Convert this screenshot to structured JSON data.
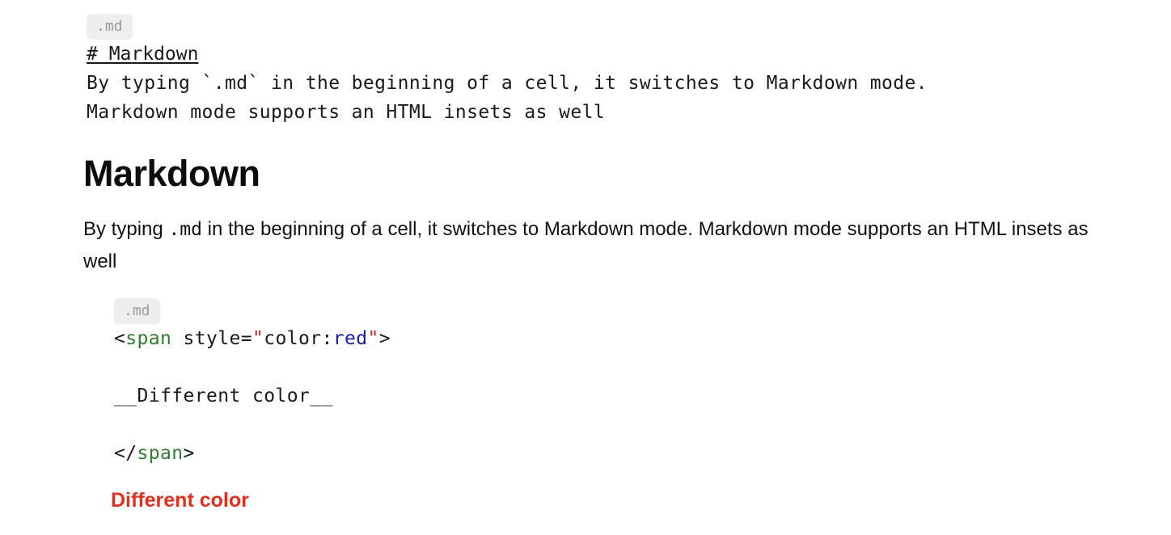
{
  "cell1": {
    "badge": ".md",
    "source_heading": "# Markdown",
    "source_line1": "By typing `.md` in the beginning of a cell, it switches to Markdown mode.",
    "source_line2": "Markdown mode supports an HTML insets as well",
    "rendered_heading": "Markdown",
    "rendered_text_before_code": "By typing ",
    "rendered_code": ".md",
    "rendered_text_after_code": " in the beginning of a cell, it switches to Markdown mode. Markdown mode supports an HTML insets as well"
  },
  "cell2": {
    "badge": ".md",
    "code": {
      "line1_open": "<",
      "line1_tag": "span",
      "line1_attr": " style=",
      "line1_q1": "\"",
      "line1_prop": "color:",
      "line1_value": "red",
      "line1_q2": "\"",
      "line1_close": ">",
      "line2": "__Different color__",
      "line3_open": "</",
      "line3_tag": "span",
      "line3_close": ">"
    },
    "rendered_text": "Different color",
    "rendered_color": "#e0301e"
  },
  "colors": {
    "badge_bg": "#eeeeee",
    "badge_text": "#9b9b9b",
    "tag": "#2e7d32",
    "string_quote": "#c62828",
    "value": "#1a1aa6"
  }
}
